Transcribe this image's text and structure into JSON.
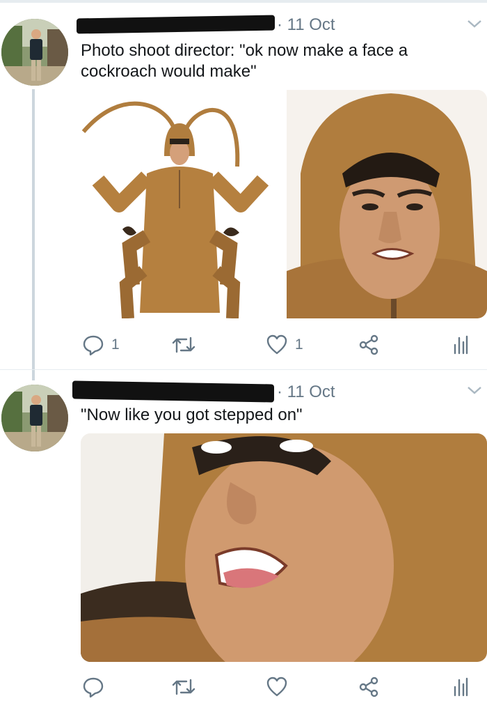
{
  "tweets": [
    {
      "header": {
        "dot_time": "· 11 Oct"
      },
      "text": "Photo shoot director: \"ok now make a face a cockroach would make\"",
      "actions": {
        "reply_count": "1",
        "retweet_count": "",
        "like_count": "1"
      }
    },
    {
      "header": {
        "dot_time": "· 11 Oct"
      },
      "text": "\"Now like you got stepped on\"",
      "actions": {
        "reply_count": "",
        "retweet_count": "",
        "like_count": ""
      }
    }
  ],
  "colors": {
    "text": "#14171a",
    "meta": "#657786",
    "thread_line": "#ccd6dd",
    "costume": "#b5803f"
  },
  "icons": [
    "reply-icon",
    "retweet-icon",
    "like-icon",
    "share-icon",
    "analytics-icon",
    "chevron-down-icon"
  ]
}
